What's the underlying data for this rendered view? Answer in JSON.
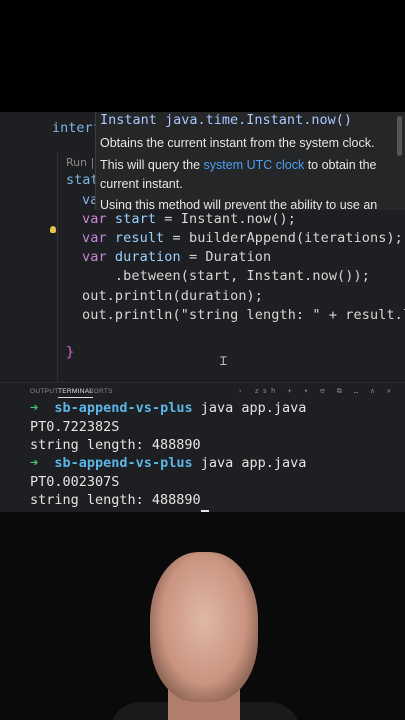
{
  "editor": {
    "interface_partial": "interf",
    "run_hint": "Run |",
    "static_partial": "stat",
    "var_partial": "va",
    "lines": [
      {
        "kw": "var",
        "name": "start",
        "rest": " = Instant.now();"
      },
      {
        "kw": "var",
        "name": "result",
        "rest": " = builderAppend(iterations);"
      },
      {
        "kw": "var",
        "name": "duration",
        "rest": " = Duration"
      },
      {
        "text": "    .between(start, Instant.now());"
      },
      {
        "text": "out.println(duration);"
      },
      {
        "text": "out.println(\"string length: \" + result.len"
      }
    ],
    "closing_brace": "}"
  },
  "tooltip": {
    "signature": "Instant java.time.Instant.now()",
    "line1": "Obtains the current instant from the system clock.",
    "line2_pre": "This will query the ",
    "line2_link": "system UTC clock",
    "line2_post": " to obtain the",
    "line3": "current instant.",
    "line4": "Using this method will prevent the ability to use an"
  },
  "panel": {
    "tabs": [
      "OUTPUT",
      "TERMINAL",
      "PORTS"
    ],
    "active_tab": "TERMINAL",
    "icons": "› zsh + ▾ ⊟ ⧉ … ∧ ✕"
  },
  "terminal": {
    "arrow": "➜",
    "dir": "sb-append-vs-plus",
    "cmd": " java app.java",
    "out1": "PT0.722382S",
    "len1": "string length: 488890",
    "out2": "PT0.002307S",
    "len2": "string length: 488890"
  }
}
